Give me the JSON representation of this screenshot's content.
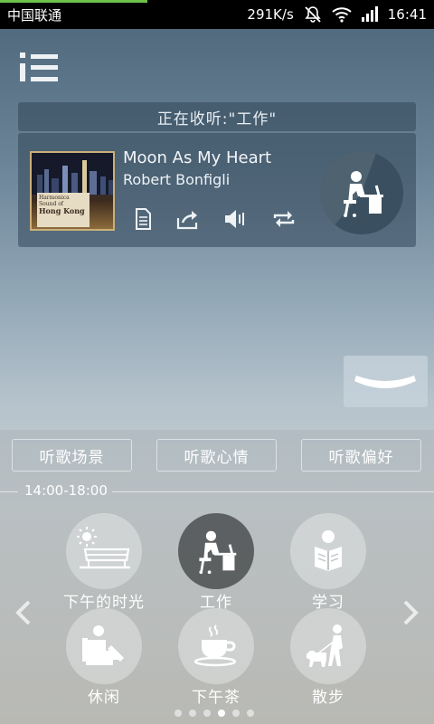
{
  "status_bar": {
    "carrier": "中国联通",
    "speed": "291K/s",
    "time": "16:41"
  },
  "header": {
    "menu_icon": "menu-list-icon",
    "now_listening": "正在收听:\"工作\""
  },
  "player": {
    "album_art": {
      "line1": "Harmonica Sound of",
      "line2": "Hong Kong"
    },
    "song_title": "Moon As My Heart",
    "artist": "Robert Bonfigli",
    "controls": [
      "lyrics-icon",
      "share-icon",
      "volume-icon",
      "repeat-icon"
    ],
    "mode_icon": "work-desk-icon"
  },
  "tabs": [
    "听歌场景",
    "听歌心情",
    "听歌偏好"
  ],
  "time_range": "14:00-18:00",
  "scenes": [
    {
      "label": "下午的时光",
      "icon": "sunny-bench-icon",
      "active": false
    },
    {
      "label": "工作",
      "icon": "work-desk-icon",
      "active": true
    },
    {
      "label": "学习",
      "icon": "study-reading-icon",
      "active": false
    },
    {
      "label": "休闲",
      "icon": "armchair-relax-icon",
      "active": false
    },
    {
      "label": "下午茶",
      "icon": "tea-cup-icon",
      "active": false
    },
    {
      "label": "散步",
      "icon": "dog-walk-icon",
      "active": false
    }
  ],
  "pager": {
    "total": 6,
    "current": 4
  },
  "colors": {
    "progress": "#6fc24a",
    "panel": "#324658"
  }
}
